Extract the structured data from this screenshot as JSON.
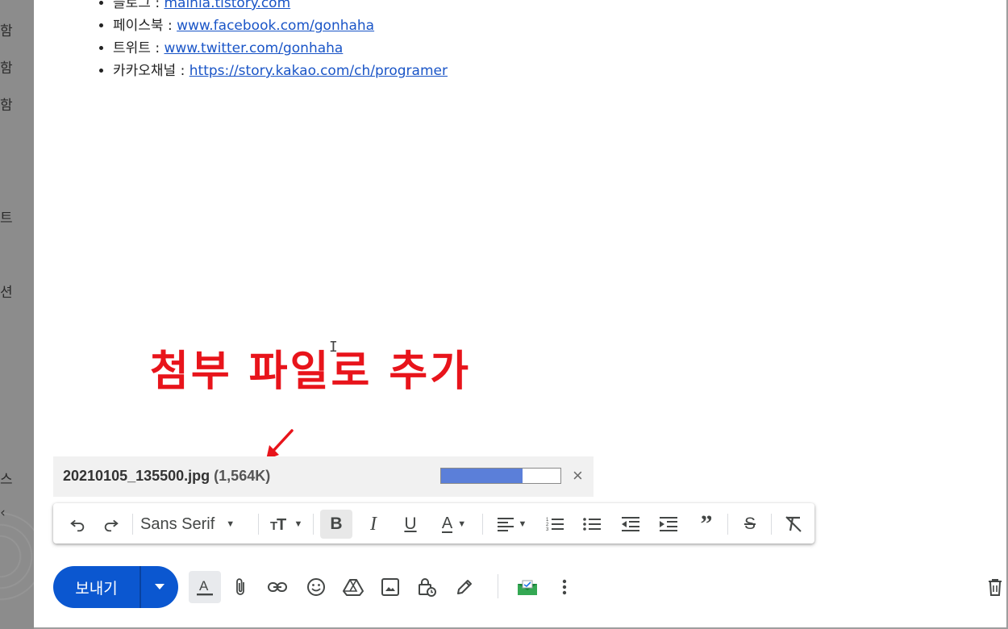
{
  "backdrop": {
    "fragments": [
      "함",
      "함",
      "함",
      "트",
      "션",
      "스",
      "‹"
    ]
  },
  "message": {
    "links": [
      {
        "label": "블로그 : ",
        "url": "mainia.tistory.com"
      },
      {
        "label": "페이스북 : ",
        "url": "www.facebook.com/gonhaha"
      },
      {
        "label": "트위트 : ",
        "url": "www.twitter.com/gonhaha"
      },
      {
        "label": "카카오채널 : ",
        "url": "https://story.kakao.com/ch/programer"
      }
    ]
  },
  "annotation": {
    "text": "첨부 파일로 추가",
    "color": "#e8141b"
  },
  "attachment": {
    "filename": "20210105_135500.jpg",
    "size": "(1,564K)",
    "progress_fraction": 0.68,
    "close_glyph": "×"
  },
  "format_toolbar": {
    "font": "Sans Serif",
    "bold_active": true,
    "icons": [
      "undo-icon",
      "redo-icon",
      "font-size-icon",
      "bold-icon",
      "italic-icon",
      "underline-icon",
      "text-color-icon",
      "align-icon",
      "numbered-list-icon",
      "bulleted-list-icon",
      "indent-less-icon",
      "indent-more-icon",
      "quote-icon",
      "strikethrough-icon",
      "remove-formatting-icon"
    ]
  },
  "actions": {
    "send_label": "보내기",
    "accent": "#0b57d0",
    "icons": [
      "formatting-options-icon",
      "attach-file-icon",
      "insert-link-icon",
      "emoji-icon",
      "google-drive-icon",
      "insert-photo-icon",
      "confidential-mode-icon",
      "signature-icon",
      "mail-merge-icon",
      "more-options-icon",
      "discard-draft-icon"
    ]
  }
}
